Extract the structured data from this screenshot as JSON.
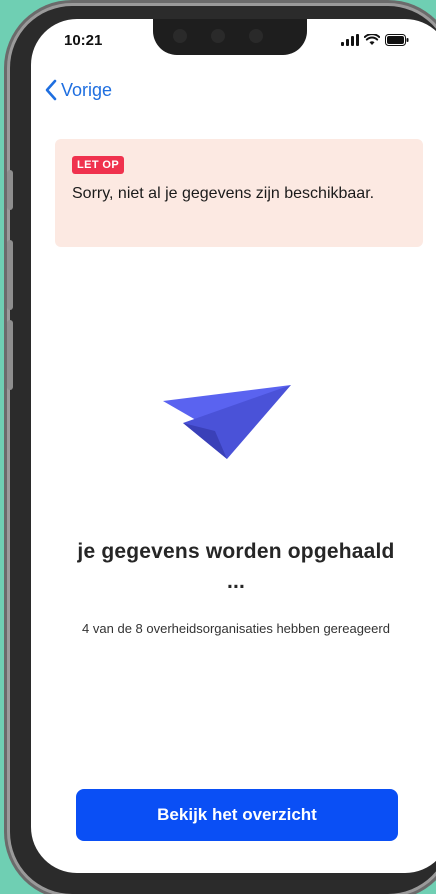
{
  "status_bar": {
    "time": "10:21"
  },
  "nav": {
    "back_label": "Vorige"
  },
  "alert": {
    "badge": "LET OP",
    "message": "Sorry, niet al je gegevens zijn beschikbaar."
  },
  "progress": {
    "heading": "je gegevens worden opgehaald ...",
    "subtext": "4 van de 8 overheidsorganisaties hebben gereageerd"
  },
  "action": {
    "button_label": "Bekijk het overzicht"
  },
  "colors": {
    "background": "#6fcfb3",
    "alert_background": "#fce9e2",
    "badge": "#f0324e",
    "link": "#1f6fe0",
    "primary_button": "#0a4ff5",
    "plane": "#5a63f0"
  },
  "icons": {
    "back": "chevron-left-icon",
    "illustration": "paper-plane-icon",
    "signal": "signal-icon",
    "wifi": "wifi-icon",
    "battery": "battery-icon"
  }
}
